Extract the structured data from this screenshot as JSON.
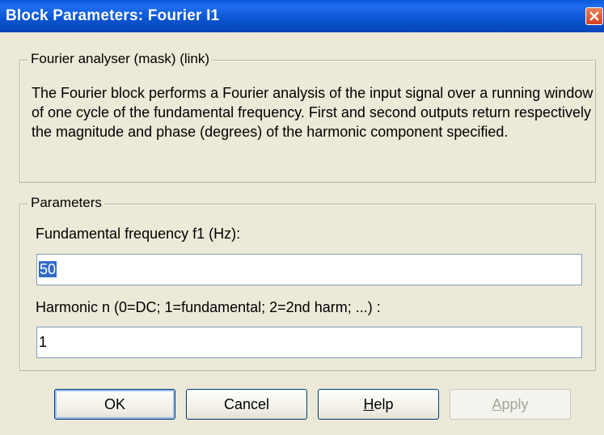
{
  "window": {
    "title": "Block Parameters: Fourier I1"
  },
  "description_group": {
    "legend": "Fourier analyser (mask) (link)",
    "text": "The Fourier block performs a Fourier analysis of the input signal over a running window of one cycle of the fundamental frequency. First and second outputs return respectively the magnitude and phase (degrees) of the harmonic component specified."
  },
  "parameters_group": {
    "legend": "Parameters",
    "fundamental_label": "Fundamental frequency f1 (Hz):",
    "fundamental_value": "50",
    "harmonic_label": "Harmonic n (0=DC; 1=fundamental; 2=2nd harm;  ...) :",
    "harmonic_value": "1"
  },
  "buttons": {
    "ok": "OK",
    "cancel": "Cancel",
    "help_mnemonic": "H",
    "help_rest": "elp",
    "apply_mnemonic": "A",
    "apply_rest": "pply"
  },
  "icons": {
    "close": "close-icon"
  },
  "colors": {
    "titlebar": "#0a54d0",
    "dialog_bg": "#ece9d8",
    "selection": "#316ac5",
    "close_button": "#d3431b"
  }
}
